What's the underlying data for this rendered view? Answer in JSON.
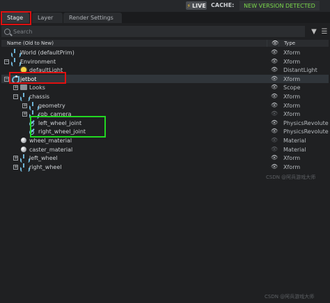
{
  "topbar": {
    "live_label": "LIVE",
    "cache_label": "CACHE:",
    "new_version_label": "NEW VERSION DETECTED"
  },
  "tabs": [
    {
      "label": "Stage",
      "active": true
    },
    {
      "label": "Layer",
      "active": false
    },
    {
      "label": "Render Settings",
      "active": false
    }
  ],
  "search": {
    "placeholder": "Search"
  },
  "columns": {
    "name": "Name (Old to New)",
    "type": "Type"
  },
  "tree": [
    {
      "label": "World (defaultPrim)",
      "type": "Xform",
      "depth": 0,
      "expander": "none",
      "icon": "xform-icon",
      "visible": true
    },
    {
      "label": "Environment",
      "type": "Xform",
      "depth": 0,
      "expander": "minus",
      "icon": "xform-icon",
      "visible": true
    },
    {
      "label": "defaultLight",
      "type": "DistantLight",
      "depth": 1,
      "expander": "none",
      "icon": "light-icon",
      "visible": true
    },
    {
      "label": "jetbot",
      "type": "Xform",
      "depth": 0,
      "expander": "minus",
      "icon": "jetbot-icon",
      "visible": true,
      "selected": true
    },
    {
      "label": "Looks",
      "type": "Scope",
      "depth": 1,
      "expander": "plus",
      "icon": "folder-icon",
      "visible": true
    },
    {
      "label": "chassis",
      "type": "Xform",
      "depth": 1,
      "expander": "minus",
      "icon": "xform-icon",
      "visible": true
    },
    {
      "label": "geometry",
      "type": "Xform",
      "depth": 2,
      "expander": "plus",
      "icon": "xform-icon",
      "visible": true
    },
    {
      "label": "rgb_camera",
      "type": "Xform",
      "depth": 2,
      "expander": "plus",
      "icon": "xform-icon",
      "visible": false
    },
    {
      "label": "left_wheel_joint",
      "type": "PhysicsRevolute",
      "depth": 2,
      "expander": "none",
      "icon": "joint-icon",
      "visible": true
    },
    {
      "label": "right_wheel_joint",
      "type": "PhysicsRevolute",
      "depth": 2,
      "expander": "none",
      "icon": "joint-icon",
      "visible": true
    },
    {
      "label": "wheel_material",
      "type": "Material",
      "depth": 1,
      "expander": "none",
      "icon": "material-icon",
      "visible": false
    },
    {
      "label": "caster_material",
      "type": "Material",
      "depth": 1,
      "expander": "none",
      "icon": "material-icon",
      "visible": false
    },
    {
      "label": "left_wheel",
      "type": "Xform",
      "depth": 1,
      "expander": "plus",
      "icon": "xform-icon",
      "visible": true
    },
    {
      "label": "right_wheel",
      "type": "Xform",
      "depth": 1,
      "expander": "plus",
      "icon": "xform-icon",
      "visible": true
    }
  ],
  "watermark": "CSDN @阿兵游戏大师"
}
